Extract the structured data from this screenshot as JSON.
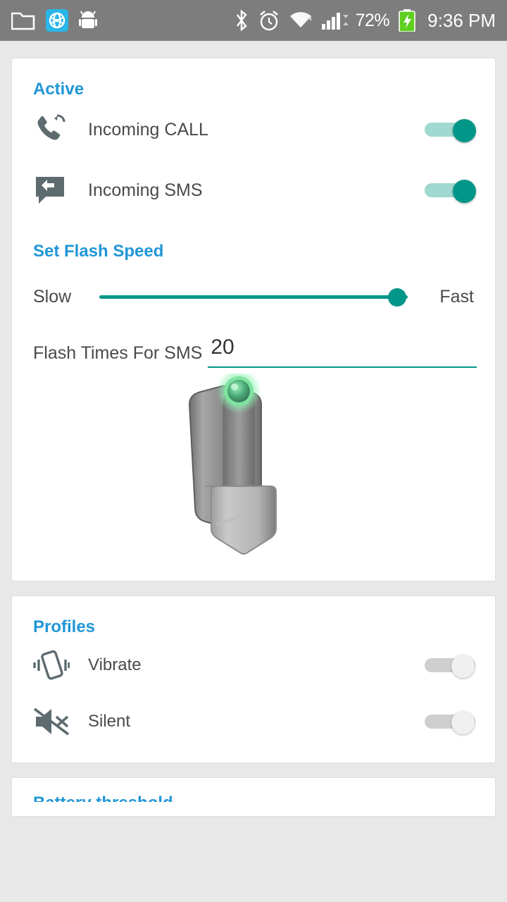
{
  "statusbar": {
    "left_icons": [
      "folder-icon",
      "browser-icon",
      "android-robot-icon"
    ],
    "right_icons": [
      "bluetooth-icon",
      "alarm-icon",
      "wifi-icon",
      "signal-icon"
    ],
    "battery_percent": "72%",
    "battery_icon": "battery-charging-icon",
    "clock": "9:36 PM"
  },
  "accent": {
    "heading_blue": "#2196d6",
    "teal": "#009688",
    "track_teal": "#9fd9d0",
    "off_gray": "#cfcfcf"
  },
  "active_card": {
    "title": "Active",
    "rows": [
      {
        "icon": "incoming-call-icon",
        "label": "Incoming CALL",
        "toggle": "on"
      },
      {
        "icon": "incoming-sms-icon",
        "label": "Incoming SMS",
        "toggle": "on"
      }
    ],
    "flash_speed": {
      "title": "Set Flash Speed",
      "min_label": "Slow",
      "max_label": "Fast",
      "value_percent": 100
    },
    "flash_times": {
      "label": "Flash Times For SMS",
      "value": "20"
    },
    "image": "flashlight-illustration"
  },
  "profiles_card": {
    "title": "Profiles",
    "rows": [
      {
        "icon": "vibrate-icon",
        "label": "Vibrate",
        "toggle": "off"
      },
      {
        "icon": "silent-icon",
        "label": "Silent",
        "toggle": "off"
      }
    ]
  },
  "next_card": {
    "title": "Battery threshold"
  }
}
